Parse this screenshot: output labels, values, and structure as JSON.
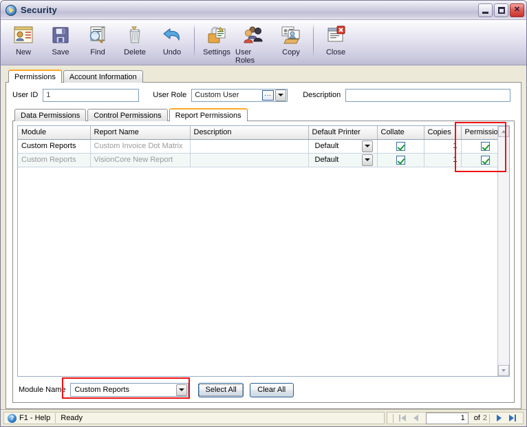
{
  "window": {
    "title": "Security",
    "icon": "app-media-icon",
    "buttons": {
      "minimize": "minimize-icon",
      "maximize": "maximize-icon",
      "close": "close-icon"
    }
  },
  "toolbar": {
    "items": [
      {
        "label": "New",
        "icon": "new-user-card-icon"
      },
      {
        "label": "Save",
        "icon": "floppy-disk-icon"
      },
      {
        "label": "Find",
        "icon": "magnifier-icon"
      },
      {
        "label": "Delete",
        "icon": "trash-can-icon"
      },
      {
        "label": "Undo",
        "icon": "undo-arrow-icon"
      },
      {
        "label": "Settings",
        "icon": "padlock-key-icon"
      },
      {
        "label": "User Roles",
        "icon": "users-group-icon"
      },
      {
        "label": "Copy",
        "icon": "copy-card-icon"
      },
      {
        "label": "Close",
        "icon": "close-document-icon"
      }
    ]
  },
  "outer_tabs": [
    {
      "label": "Permissions",
      "active": true
    },
    {
      "label": "Account Information",
      "active": false
    }
  ],
  "form": {
    "user_id_label": "User ID",
    "user_id_value": "1",
    "user_role_label": "User Role",
    "user_role_value": "Custom User",
    "user_role_ellipsis": "...",
    "description_label": "Description",
    "description_value": ""
  },
  "inner_tabs": [
    {
      "label": "Data Permissions",
      "active": false
    },
    {
      "label": "Control Permissions",
      "active": false
    },
    {
      "label": "Report Permissions",
      "active": true
    }
  ],
  "grid": {
    "columns": [
      "Module",
      "Report Name",
      "Description",
      "Default Printer",
      "Collate",
      "Copies",
      "Permission"
    ],
    "rows": [
      {
        "module": "Custom Reports",
        "report_name": "Custom Invoice Dot Matrix",
        "description": "",
        "default_printer": "Default",
        "collate": true,
        "copies": "1",
        "permission": true,
        "module_emphasis": true
      },
      {
        "module": "Custom Reports",
        "report_name": "VisionCore New Report",
        "description": "",
        "default_printer": "Default",
        "collate": true,
        "copies": "1",
        "permission": true,
        "module_emphasis": false
      }
    ]
  },
  "bottom": {
    "module_name_label": "Module Name",
    "module_name_value": "Custom Reports",
    "select_all_label": "Select All",
    "clear_all_label": "Clear All"
  },
  "statusbar": {
    "help_text": "F1 - Help",
    "status_text": "Ready",
    "nav": {
      "first": "first-record-icon",
      "prev": "previous-record-icon",
      "current_page": "1",
      "of_label": "of",
      "total_pages": "2",
      "next": "next-record-icon",
      "last": "last-record-icon"
    }
  },
  "annotations": {
    "permission_column_highlight": "red-rectangle",
    "module_name_highlight": "red-rectangle",
    "color": "#ee1111"
  }
}
